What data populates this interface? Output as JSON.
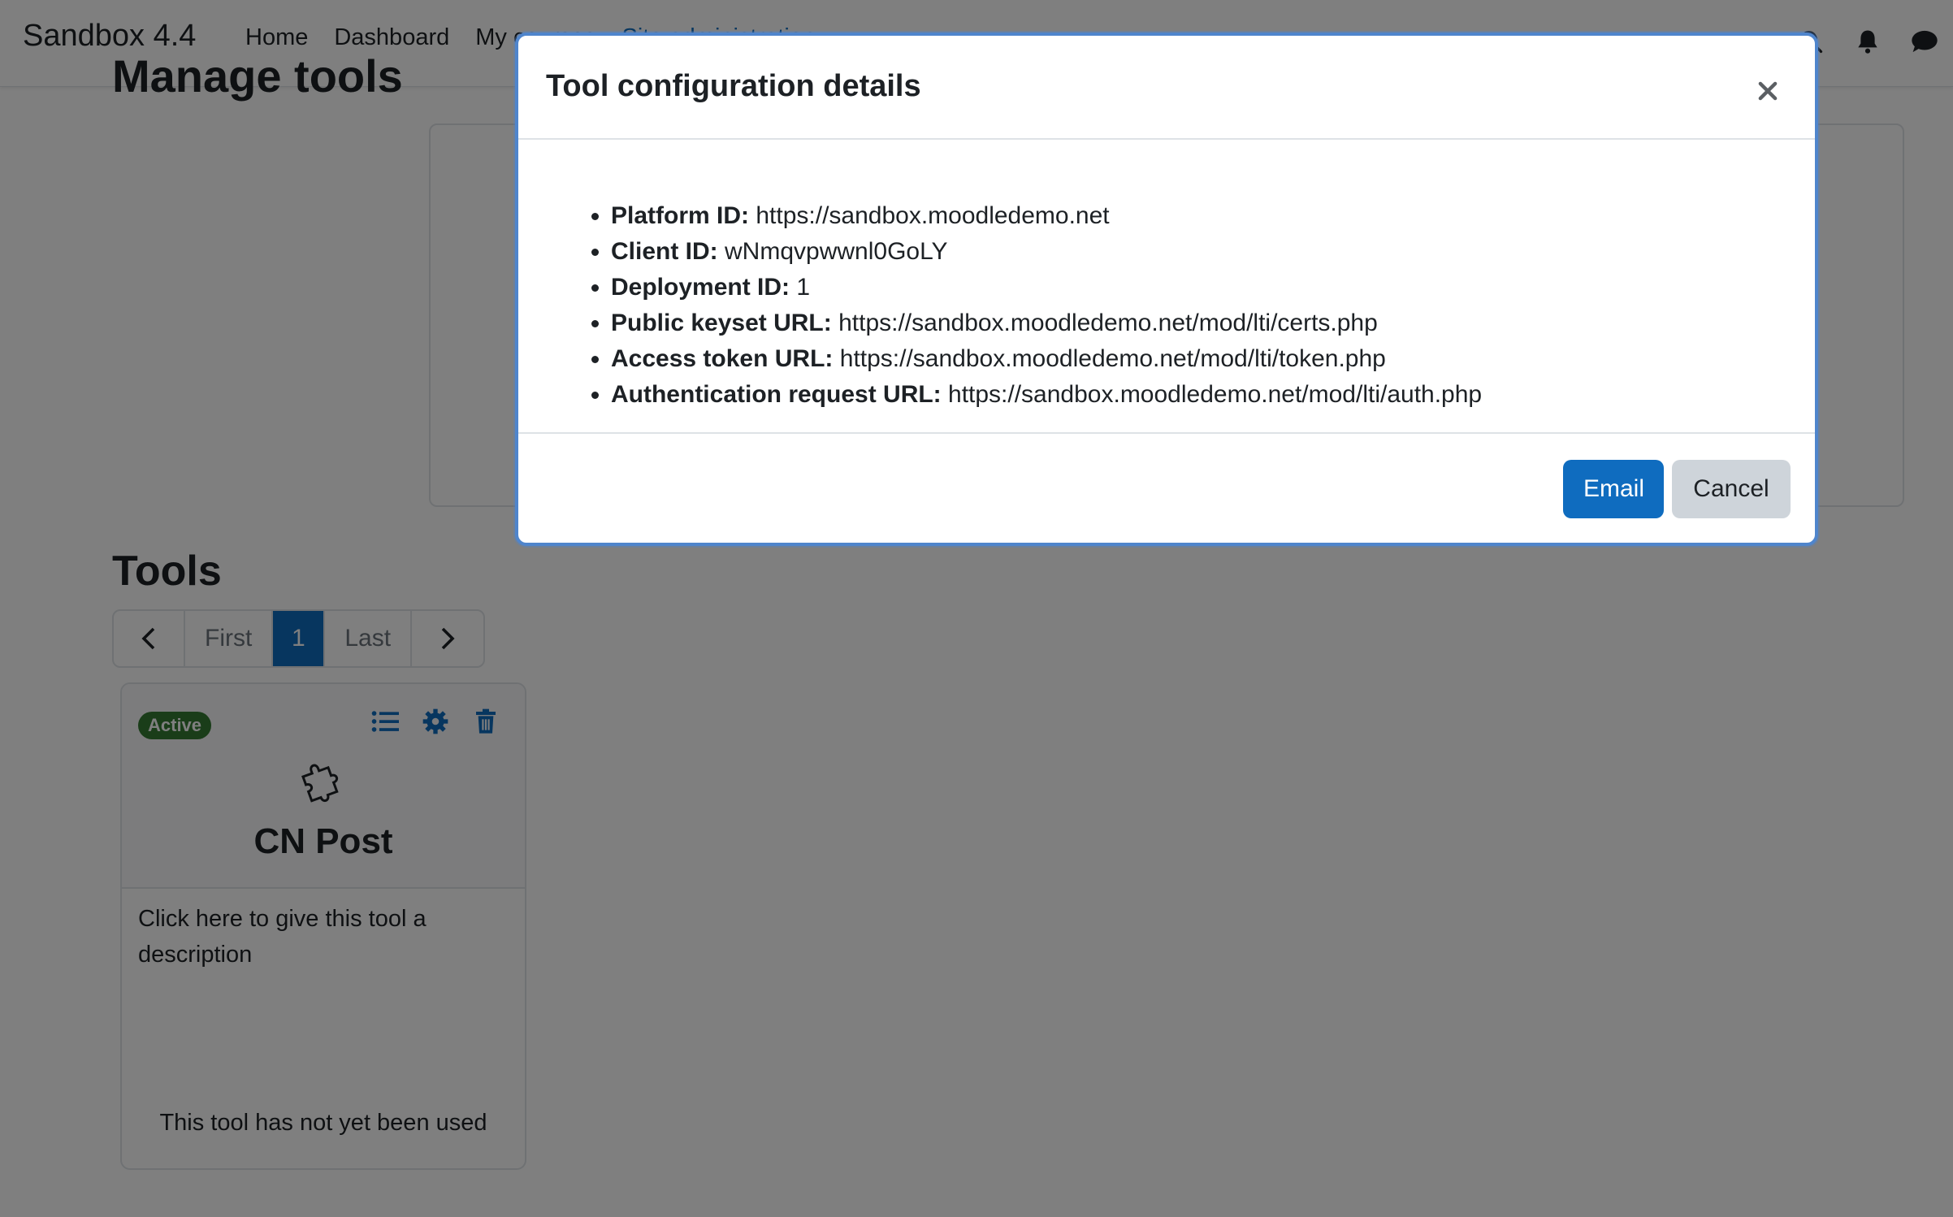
{
  "navbar": {
    "brand": "Sandbox 4.4",
    "links": [
      {
        "label": "Home"
      },
      {
        "label": "Dashboard"
      },
      {
        "label": "My courses"
      },
      {
        "label": "Site administration"
      }
    ],
    "icons": [
      "search-icon",
      "bell-icon",
      "chat-icon"
    ]
  },
  "page": {
    "title": "Manage tools",
    "tools_heading": "Tools"
  },
  "pagination": {
    "prev_icon": "chevron-left-icon",
    "first": "First",
    "current": "1",
    "last": "Last",
    "next_icon": "chevron-right-icon"
  },
  "tool_card": {
    "status": "Active",
    "status_color": "#357a32",
    "actions": [
      "list-icon",
      "gear-icon",
      "trash-icon"
    ],
    "icon": "puzzle-icon",
    "name": "CN Post",
    "description": "Click here to give this tool a description",
    "usage": "This tool has not yet been used"
  },
  "modal": {
    "title": "Tool configuration details",
    "details": [
      {
        "label": "Platform ID:",
        "value": "https://sandbox.moodledemo.net"
      },
      {
        "label": "Client ID:",
        "value": "wNmqvpwwnl0GoLY"
      },
      {
        "label": "Deployment ID:",
        "value": "1"
      },
      {
        "label": "Public keyset URL:",
        "value": "https://sandbox.moodledemo.net/mod/lti/certs.php"
      },
      {
        "label": "Access token URL:",
        "value": "https://sandbox.moodledemo.net/mod/lti/token.php"
      },
      {
        "label": "Authentication request URL:",
        "value": "https://sandbox.moodledemo.net/mod/lti/auth.php"
      }
    ],
    "email_label": "Email",
    "cancel_label": "Cancel"
  },
  "colors": {
    "primary": "#0f6cbf",
    "modal_border": "#4f85cc"
  }
}
